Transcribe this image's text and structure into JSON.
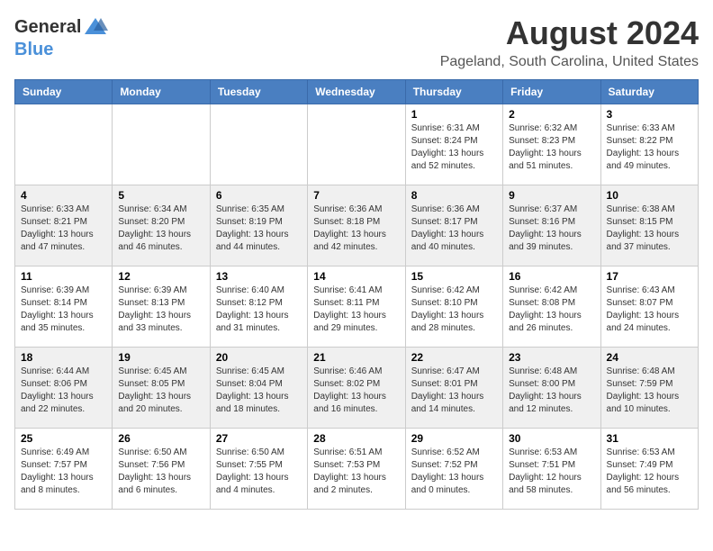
{
  "header": {
    "logo_general": "General",
    "logo_blue": "Blue",
    "month_title": "August 2024",
    "location": "Pageland, South Carolina, United States"
  },
  "days_of_week": [
    "Sunday",
    "Monday",
    "Tuesday",
    "Wednesday",
    "Thursday",
    "Friday",
    "Saturday"
  ],
  "weeks": [
    [
      {
        "day": "",
        "info": ""
      },
      {
        "day": "",
        "info": ""
      },
      {
        "day": "",
        "info": ""
      },
      {
        "day": "",
        "info": ""
      },
      {
        "day": "1",
        "info": "Sunrise: 6:31 AM\nSunset: 8:24 PM\nDaylight: 13 hours\nand 52 minutes."
      },
      {
        "day": "2",
        "info": "Sunrise: 6:32 AM\nSunset: 8:23 PM\nDaylight: 13 hours\nand 51 minutes."
      },
      {
        "day": "3",
        "info": "Sunrise: 6:33 AM\nSunset: 8:22 PM\nDaylight: 13 hours\nand 49 minutes."
      }
    ],
    [
      {
        "day": "4",
        "info": "Sunrise: 6:33 AM\nSunset: 8:21 PM\nDaylight: 13 hours\nand 47 minutes."
      },
      {
        "day": "5",
        "info": "Sunrise: 6:34 AM\nSunset: 8:20 PM\nDaylight: 13 hours\nand 46 minutes."
      },
      {
        "day": "6",
        "info": "Sunrise: 6:35 AM\nSunset: 8:19 PM\nDaylight: 13 hours\nand 44 minutes."
      },
      {
        "day": "7",
        "info": "Sunrise: 6:36 AM\nSunset: 8:18 PM\nDaylight: 13 hours\nand 42 minutes."
      },
      {
        "day": "8",
        "info": "Sunrise: 6:36 AM\nSunset: 8:17 PM\nDaylight: 13 hours\nand 40 minutes."
      },
      {
        "day": "9",
        "info": "Sunrise: 6:37 AM\nSunset: 8:16 PM\nDaylight: 13 hours\nand 39 minutes."
      },
      {
        "day": "10",
        "info": "Sunrise: 6:38 AM\nSunset: 8:15 PM\nDaylight: 13 hours\nand 37 minutes."
      }
    ],
    [
      {
        "day": "11",
        "info": "Sunrise: 6:39 AM\nSunset: 8:14 PM\nDaylight: 13 hours\nand 35 minutes."
      },
      {
        "day": "12",
        "info": "Sunrise: 6:39 AM\nSunset: 8:13 PM\nDaylight: 13 hours\nand 33 minutes."
      },
      {
        "day": "13",
        "info": "Sunrise: 6:40 AM\nSunset: 8:12 PM\nDaylight: 13 hours\nand 31 minutes."
      },
      {
        "day": "14",
        "info": "Sunrise: 6:41 AM\nSunset: 8:11 PM\nDaylight: 13 hours\nand 29 minutes."
      },
      {
        "day": "15",
        "info": "Sunrise: 6:42 AM\nSunset: 8:10 PM\nDaylight: 13 hours\nand 28 minutes."
      },
      {
        "day": "16",
        "info": "Sunrise: 6:42 AM\nSunset: 8:08 PM\nDaylight: 13 hours\nand 26 minutes."
      },
      {
        "day": "17",
        "info": "Sunrise: 6:43 AM\nSunset: 8:07 PM\nDaylight: 13 hours\nand 24 minutes."
      }
    ],
    [
      {
        "day": "18",
        "info": "Sunrise: 6:44 AM\nSunset: 8:06 PM\nDaylight: 13 hours\nand 22 minutes."
      },
      {
        "day": "19",
        "info": "Sunrise: 6:45 AM\nSunset: 8:05 PM\nDaylight: 13 hours\nand 20 minutes."
      },
      {
        "day": "20",
        "info": "Sunrise: 6:45 AM\nSunset: 8:04 PM\nDaylight: 13 hours\nand 18 minutes."
      },
      {
        "day": "21",
        "info": "Sunrise: 6:46 AM\nSunset: 8:02 PM\nDaylight: 13 hours\nand 16 minutes."
      },
      {
        "day": "22",
        "info": "Sunrise: 6:47 AM\nSunset: 8:01 PM\nDaylight: 13 hours\nand 14 minutes."
      },
      {
        "day": "23",
        "info": "Sunrise: 6:48 AM\nSunset: 8:00 PM\nDaylight: 13 hours\nand 12 minutes."
      },
      {
        "day": "24",
        "info": "Sunrise: 6:48 AM\nSunset: 7:59 PM\nDaylight: 13 hours\nand 10 minutes."
      }
    ],
    [
      {
        "day": "25",
        "info": "Sunrise: 6:49 AM\nSunset: 7:57 PM\nDaylight: 13 hours\nand 8 minutes."
      },
      {
        "day": "26",
        "info": "Sunrise: 6:50 AM\nSunset: 7:56 PM\nDaylight: 13 hours\nand 6 minutes."
      },
      {
        "day": "27",
        "info": "Sunrise: 6:50 AM\nSunset: 7:55 PM\nDaylight: 13 hours\nand 4 minutes."
      },
      {
        "day": "28",
        "info": "Sunrise: 6:51 AM\nSunset: 7:53 PM\nDaylight: 13 hours\nand 2 minutes."
      },
      {
        "day": "29",
        "info": "Sunrise: 6:52 AM\nSunset: 7:52 PM\nDaylight: 13 hours\nand 0 minutes."
      },
      {
        "day": "30",
        "info": "Sunrise: 6:53 AM\nSunset: 7:51 PM\nDaylight: 12 hours\nand 58 minutes."
      },
      {
        "day": "31",
        "info": "Sunrise: 6:53 AM\nSunset: 7:49 PM\nDaylight: 12 hours\nand 56 minutes."
      }
    ]
  ]
}
